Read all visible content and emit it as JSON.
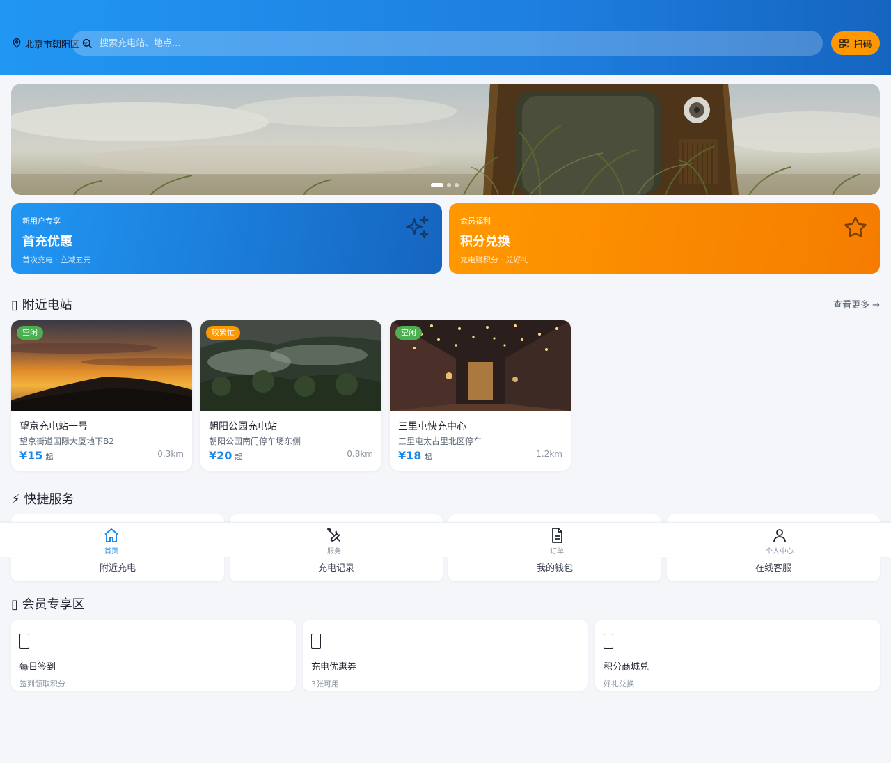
{
  "header": {
    "location_label": "北京市朝阳区",
    "search_placeholder": "搜索充电站、地点...",
    "scan_label": "扫码"
  },
  "banner": {
    "slide_count": 3,
    "active_slide": 1
  },
  "promos": [
    {
      "tag": "新用户专享",
      "title": "首充优惠",
      "sub": "首次充电 · 立减五元",
      "color": "#1e88e5"
    },
    {
      "tag": "会员福利",
      "title": "积分兑换",
      "sub": "充电赚积分 · 兑好礼",
      "color": "#fb8c00"
    }
  ],
  "nearby": {
    "title": "附近电站",
    "more_label": "查看更多 →",
    "cards": [
      {
        "badge": "空闲",
        "badge_color": "green",
        "name": "望京充电站一号",
        "addr": "望京街道国际大厦地下B2",
        "price": "¥15",
        "unit": "起",
        "dist": "0.3km"
      },
      {
        "badge": "较繁忙",
        "badge_color": "orange",
        "name": "朝阳公园充电站",
        "addr": "朝阳公园南门停车场东侧",
        "price": "¥20",
        "unit": "起",
        "dist": "0.8km"
      },
      {
        "badge": "空闲",
        "badge_color": "green",
        "name": "三里屯快充中心",
        "addr": "三里屯太古里北区停车",
        "price": "¥18",
        "unit": "起",
        "dist": "1.2km"
      }
    ]
  },
  "services": {
    "title": "快捷服务",
    "items": [
      "附近充电",
      "充电记录",
      "我的钱包",
      "在线客服"
    ]
  },
  "members": {
    "title": "会员专享区",
    "items": [
      {
        "title": "每日签到",
        "sub": "签到领取积分"
      },
      {
        "title": "充电优惠券",
        "sub": "3张可用"
      },
      {
        "title": "积分商城兑",
        "sub": "好礼兑换"
      }
    ]
  },
  "nav": {
    "items": [
      {
        "label": "首页",
        "icon": "home-icon",
        "active": true
      },
      {
        "label": "服务",
        "icon": "tools-icon",
        "active": false
      },
      {
        "label": "订单",
        "icon": "document-icon",
        "active": false
      },
      {
        "label": "个人中心",
        "icon": "user-icon",
        "active": false
      }
    ]
  },
  "colors": {
    "primary": "#1e88e5",
    "accent": "#ff9800",
    "available": "#4caf50",
    "background": "#f4f6fa"
  }
}
